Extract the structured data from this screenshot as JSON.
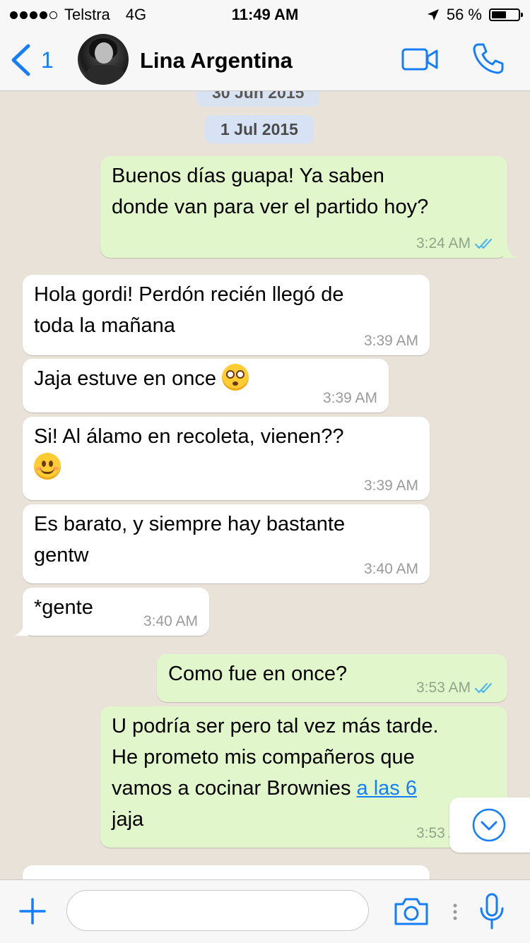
{
  "status_bar": {
    "carrier": "Telstra",
    "network": "4G",
    "time": "11:49 AM",
    "battery": "56 %",
    "battery_level": 0.56,
    "signal_bars": 4
  },
  "header": {
    "back_count": "1",
    "contact_name": "Lina Argentina"
  },
  "chat": {
    "date_prev": "30 Jun 2015",
    "date_current": "1 Jul 2015",
    "messages": [
      {
        "dir": "out",
        "line1": "Buenos días guapa! Ya saben",
        "line2": "donde van para ver el partido hoy?",
        "time": "3:24 AM",
        "ticks": "read"
      },
      {
        "dir": "in",
        "line1": "Hola gordi! Perdón recién llegó de",
        "line2": "toda la mañana",
        "time": "3:39 AM"
      },
      {
        "dir": "in",
        "line1": "Jaja estuve en once",
        "emoji": "flushed",
        "time": "3:39 AM"
      },
      {
        "dir": "in",
        "line1": "Si! Al álamo en recoleta, vienen??",
        "emoji": "smiling",
        "time": "3:39 AM"
      },
      {
        "dir": "in",
        "line1": "Es barato, y siempre hay bastante",
        "line2": "gentw",
        "time": "3:40 AM"
      },
      {
        "dir": "in",
        "line1": "*gente",
        "time": "3:40 AM"
      },
      {
        "dir": "out",
        "line1": "Como fue en once?",
        "time": "3:53 AM",
        "ticks": "read"
      },
      {
        "dir": "out",
        "line1": "U podría ser pero tal vez más tarde.",
        "line2": "He prometo mis compañeros que",
        "line3": "vamos a cocinar Brownies",
        "link": "a las 6",
        "line4": "jaja",
        "time": "3:53 AM"
      }
    ]
  },
  "colors": {
    "accent": "#147efb",
    "outgoing_bubble": "#e1f7cb",
    "incoming_bubble": "#ffffff",
    "date_pill": "#d7e3f4",
    "wallpaper": "#e8e2d9"
  },
  "icons": {
    "back": "chevron-left-icon",
    "video": "video-camera-icon",
    "call": "phone-icon",
    "scroll": "chevron-down-circle-icon",
    "add": "plus-icon",
    "camera": "camera-icon",
    "mic": "microphone-icon"
  },
  "input": {
    "value": "",
    "placeholder": ""
  }
}
